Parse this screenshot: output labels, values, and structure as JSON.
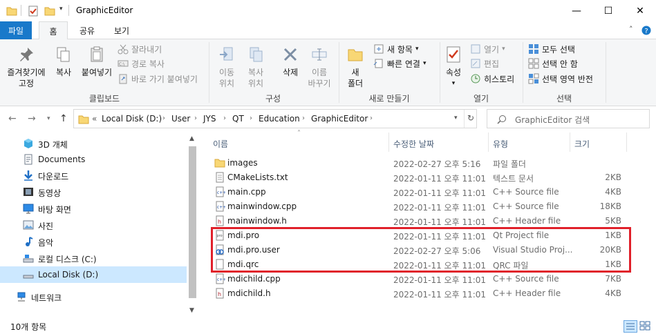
{
  "window": {
    "title": "GraphicEditor",
    "minimize_glyph": "—",
    "maximize_glyph": "☐",
    "close_glyph": "✕"
  },
  "ribbon_tabs": [
    "파일",
    "홈",
    "공유",
    "보기"
  ],
  "ribbon": {
    "clipboard": {
      "label": "클립보드",
      "pin": "즐겨찾기에\n고정",
      "copy": "복사",
      "paste": "붙여넣기",
      "cut": "잘라내기",
      "copy_path": "경로 복사",
      "paste_shortcut": "바로 가기 붙여넣기"
    },
    "organize": {
      "label": "구성",
      "move_to": "이동\n위치",
      "copy_to": "복사\n위치",
      "delete": "삭제",
      "rename": "이름\n바꾸기"
    },
    "new": {
      "label": "새로 만들기",
      "new_folder": "새\n폴더",
      "new_item": "새 항목",
      "easy_access": "빠른 연결"
    },
    "open": {
      "label": "열기",
      "properties": "속성",
      "open": "열기",
      "edit": "편집",
      "history": "히스토리"
    },
    "select": {
      "label": "선택",
      "select_all": "모두 선택",
      "select_none": "선택 안 함",
      "invert": "선택 영역 반전"
    }
  },
  "address": {
    "crumbs": [
      "Local Disk (D:)",
      "User",
      "JYS",
      "QT",
      "Education",
      "GraphicEditor"
    ],
    "overflow": "«"
  },
  "search": {
    "placeholder": "GraphicEditor 검색"
  },
  "nav_pane": [
    {
      "label": "3D 개체",
      "icon": "3d-objects-icon"
    },
    {
      "label": "Documents",
      "icon": "documents-icon"
    },
    {
      "label": "다운로드",
      "icon": "downloads-icon"
    },
    {
      "label": "동영상",
      "icon": "videos-icon"
    },
    {
      "label": "바탕 화면",
      "icon": "desktop-icon"
    },
    {
      "label": "사진",
      "icon": "pictures-icon"
    },
    {
      "label": "음악",
      "icon": "music-icon"
    },
    {
      "label": "로컬 디스크 (C:)",
      "icon": "local-disk-icon"
    },
    {
      "label": "Local Disk (D:)",
      "icon": "drive-icon",
      "selected": true
    },
    {
      "label": "네트워크",
      "icon": "network-icon"
    }
  ],
  "columns": {
    "name": "이름",
    "date": "수정한 날짜",
    "type": "유형",
    "size": "크기"
  },
  "files": [
    {
      "name": "images",
      "date": "2022-02-27 오후 5:16",
      "type": "파일 폴더",
      "size": "",
      "icon": "folder-icon"
    },
    {
      "name": "CMakeLists.txt",
      "date": "2022-01-11 오후 11:01",
      "type": "텍스트 문서",
      "size": "2KB",
      "icon": "text-file-icon"
    },
    {
      "name": "main.cpp",
      "date": "2022-01-11 오후 11:01",
      "type": "C++ Source file",
      "size": "4KB",
      "icon": "cpp-file-icon"
    },
    {
      "name": "mainwindow.cpp",
      "date": "2022-01-11 오후 11:01",
      "type": "C++ Source file",
      "size": "18KB",
      "icon": "cpp-file-icon"
    },
    {
      "name": "mainwindow.h",
      "date": "2022-01-11 오후 11:01",
      "type": "C++ Header file",
      "size": "5KB",
      "icon": "header-file-icon"
    },
    {
      "name": "mdi.pro",
      "date": "2022-01-11 오후 11:01",
      "type": "Qt Project file",
      "size": "1KB",
      "icon": "pro-file-icon"
    },
    {
      "name": "mdi.pro.user",
      "date": "2022-02-27 오후 5:06",
      "type": "Visual Studio Proj...",
      "size": "20KB",
      "icon": "user-file-icon"
    },
    {
      "name": "mdi.qrc",
      "date": "2022-01-11 오후 11:01",
      "type": "QRC 파일",
      "size": "1KB",
      "icon": "blank-file-icon"
    },
    {
      "name": "mdichild.cpp",
      "date": "2022-01-11 오후 11:01",
      "type": "C++ Source file",
      "size": "7KB",
      "icon": "cpp-file-icon"
    },
    {
      "name": "mdichild.h",
      "date": "2022-01-11 오후 11:01",
      "type": "C++ Header file",
      "size": "4KB",
      "icon": "header-file-icon"
    }
  ],
  "status": {
    "item_count": "10개 항목"
  },
  "colors": {
    "accent": "#1979ca",
    "highlight": "#e0202a",
    "selected": "#cce8ff",
    "folder": "#f8d775"
  }
}
